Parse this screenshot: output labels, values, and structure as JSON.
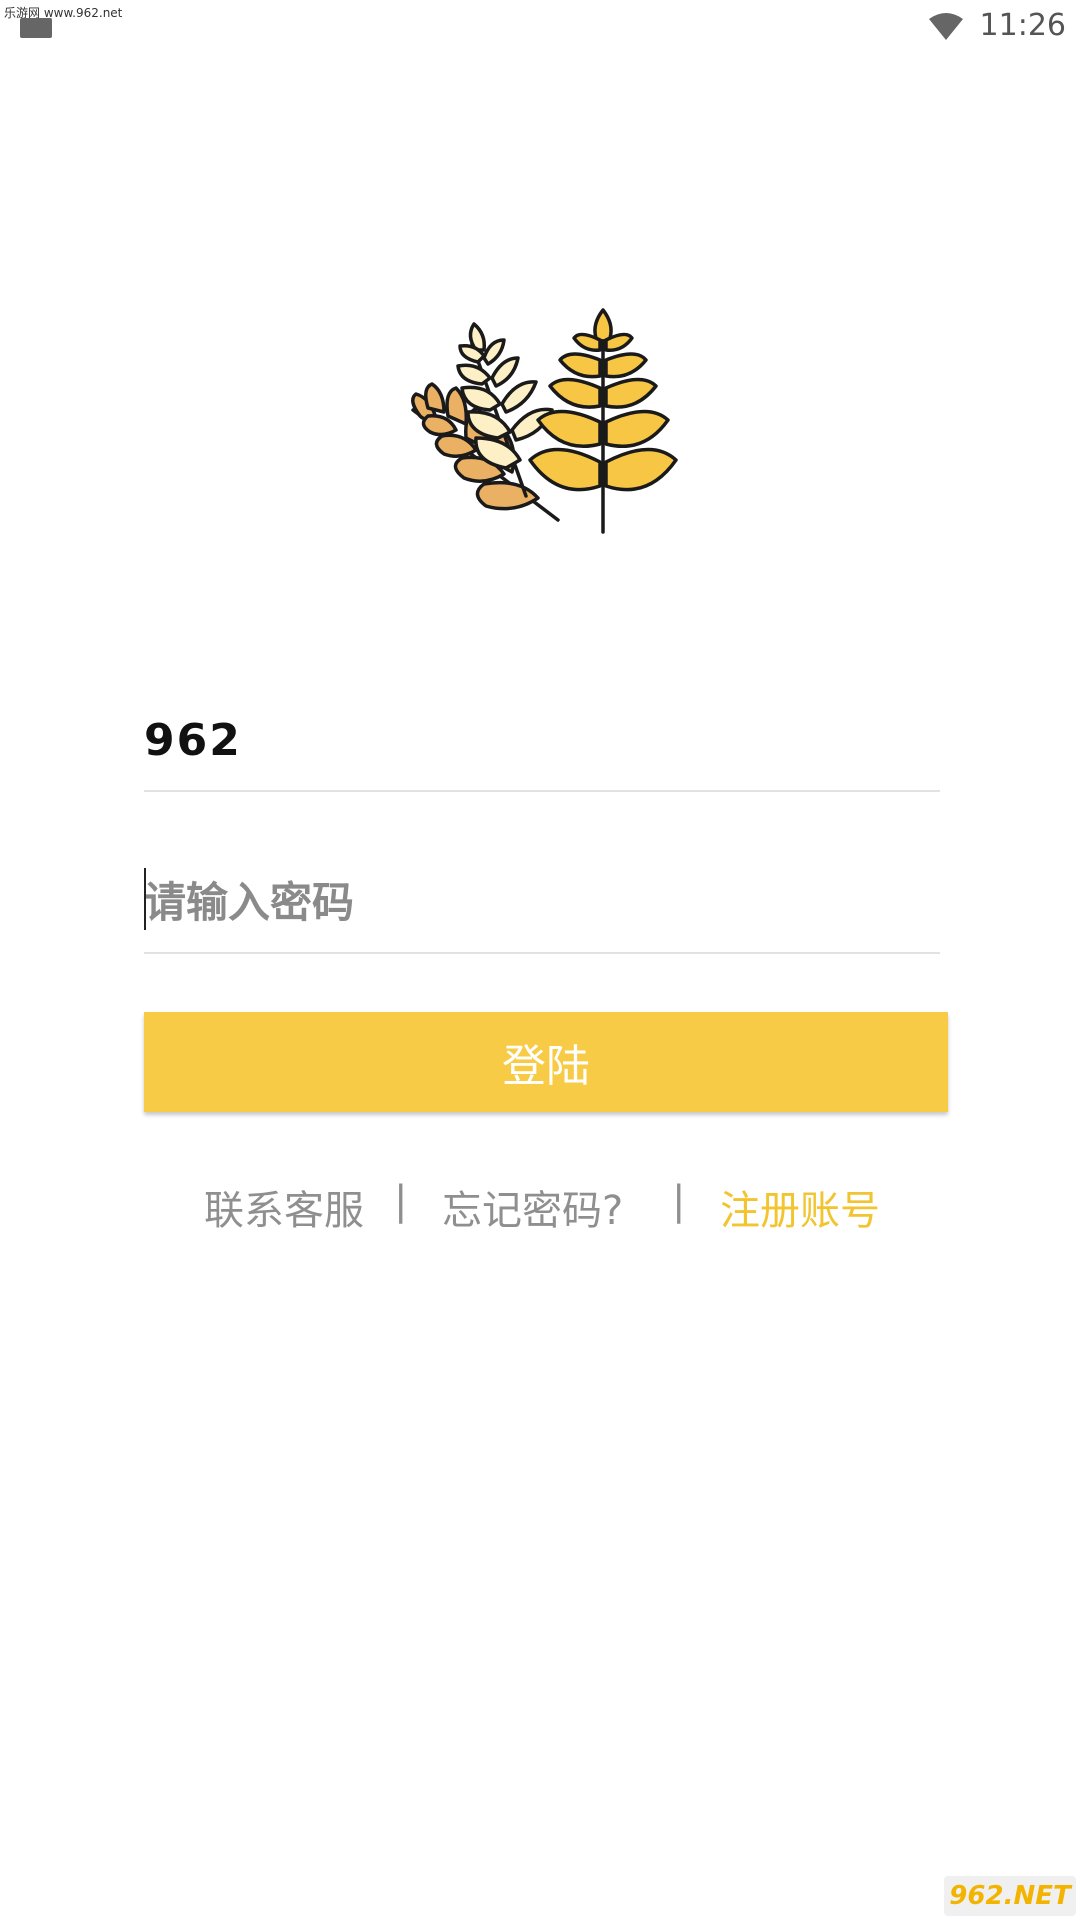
{
  "status_bar": {
    "watermark_text": "乐游网 www.962.net",
    "time": "11:26",
    "icons": [
      "notification-icon",
      "wifi-icon"
    ]
  },
  "logo": {
    "icon": "wheat-logo-icon",
    "colors": {
      "gold": "#f6c644",
      "cream": "#fdf0c6",
      "tan": "#eab063",
      "outline": "#1a1a1a"
    }
  },
  "form": {
    "username_value": "962",
    "password_placeholder": "请输入密码",
    "login_label": "登陆"
  },
  "links": {
    "service": "联系客服",
    "forgot": "忘记密码?",
    "register": "注册账号",
    "separator": "|"
  },
  "watermark": {
    "corner_text": "962.NET"
  },
  "colors": {
    "accent": "#f7cb46",
    "register_link": "#f2c530",
    "muted_text": "#8f8f8f",
    "divider": "#e2e2e2"
  }
}
